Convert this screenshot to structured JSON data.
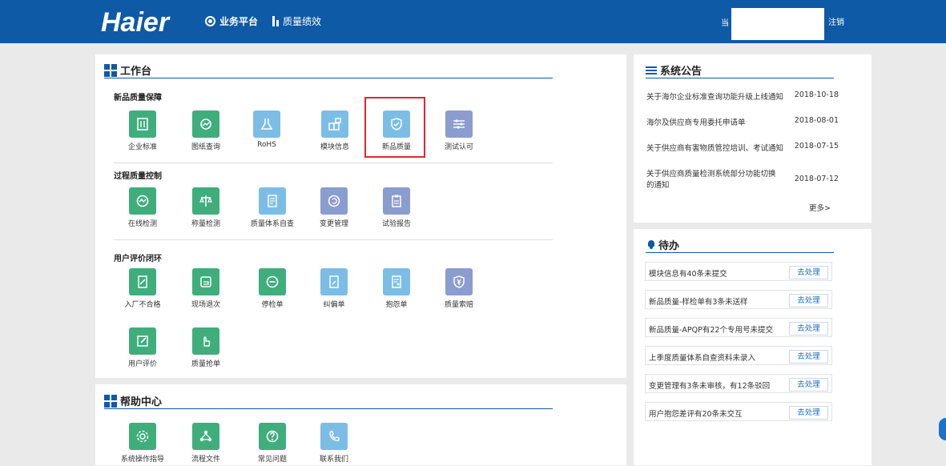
{
  "header": {
    "logo": "Haier",
    "nav": [
      {
        "label": "业务平台"
      },
      {
        "label": "质量绩效"
      }
    ],
    "user_prefix": "当",
    "logout": "注销"
  },
  "workbench": {
    "title": "工作台",
    "sections": [
      {
        "title": "新品质量保障",
        "items": [
          "企业标准",
          "图纸查询",
          "RoHS",
          "模块信息",
          "新品质量",
          "测试认可"
        ]
      },
      {
        "title": "过程质量控制",
        "items": [
          "在线检测",
          "称量检测",
          "质量体系自查",
          "变更管理",
          "试验报告"
        ]
      },
      {
        "title": "用户评价闭环",
        "items": [
          "入厂不合格",
          "现场退次",
          "停检单",
          "纠偏单",
          "抱怨单",
          "质量索赔",
          "用户评价",
          "质量抢单"
        ]
      }
    ]
  },
  "help": {
    "title": "帮助中心",
    "items": [
      "系统操作指导",
      "流程文件",
      "常见问题",
      "联系我们"
    ]
  },
  "notices": {
    "title": "系统公告",
    "items": [
      {
        "text": "关于海尔企业标准查询功能升级上线通知",
        "date": "2018-10-18"
      },
      {
        "text": "海尔及供应商专用委托申请单",
        "date": "2018-08-01"
      },
      {
        "text": "关于供应商有害物质管控培训、考试通知",
        "date": "2018-07-15"
      },
      {
        "text": "关于供应商质量检测系统部分功能切换的通知",
        "date": "2018-07-12"
      }
    ],
    "more": "更多>"
  },
  "todo": {
    "title": "待办",
    "action": "去处理",
    "items": [
      "模块信息有40条未提交",
      "新品质量-样检单有3条未送样",
      "新品质量-APQP有22个专用号未提交",
      "上季度质量体系自查资料未录入",
      "变更管理有3条未审核，有12条驳回",
      "用户抱怨差评有20条未交互"
    ]
  },
  "colors": {
    "primary": "#0e5aa7",
    "green": "#3fae7c",
    "light_blue": "#7cbde6",
    "purple": "#8b9ccf",
    "highlight": "#e3262d"
  }
}
